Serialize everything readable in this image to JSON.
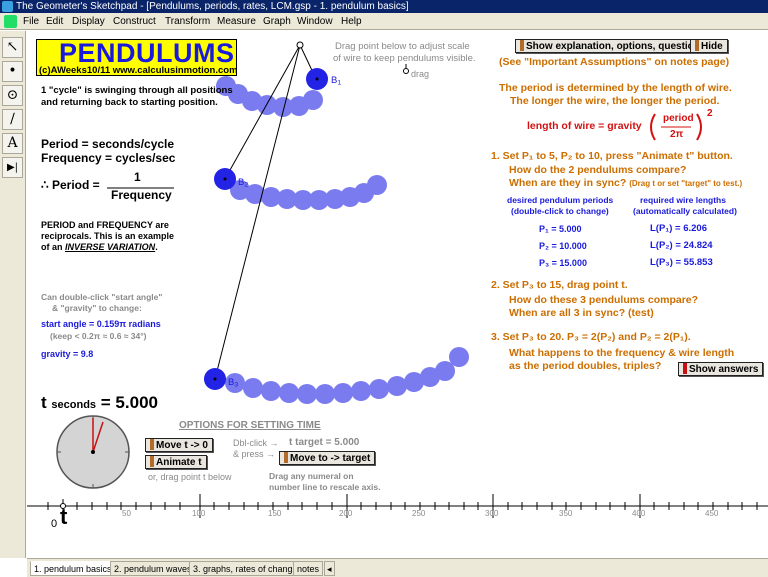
{
  "window": {
    "title": "The Geometer's Sketchpad - [Pendulums, periods, rates, LCM.gsp - 1. pendulum basics]"
  },
  "menu": [
    "File",
    "Edit",
    "Display",
    "Construct",
    "Transform",
    "Measure",
    "Graph",
    "Window",
    "Help"
  ],
  "tools": [
    {
      "name": "arrow-tool-icon",
      "glyph": "↖"
    },
    {
      "name": "point-tool-icon",
      "glyph": "•"
    },
    {
      "name": "compass-tool-icon",
      "glyph": "⊙"
    },
    {
      "name": "straightedge-tool-icon",
      "glyph": "∕"
    },
    {
      "name": "text-tool-icon",
      "glyph": "A"
    },
    {
      "name": "custom-tool-icon",
      "glyph": "▶|"
    }
  ],
  "header": {
    "title": "PENDULUMS",
    "credit": "(c)AWeeks10/11 www.calculusinmotion.com"
  },
  "cycle": {
    "line1": "1 \"cycle\" is swinging through all positions",
    "line2": "and returning back to starting position."
  },
  "defs": {
    "period": "Period = seconds/cycle",
    "frequency": "Frequency = cycles/sec",
    "therefore": "∴ Period =",
    "numerator": "1",
    "denominator": "Frequency"
  },
  "reciprocal": {
    "line1": "PERIOD and FREQUENCY are",
    "line2": "reciprocals.  This is an example",
    "line3_prefix": "of an ",
    "line3_em": "INVERSE VARIATION",
    "line3_suffix": "."
  },
  "params": {
    "hint1": "Can double-click \"start angle\"",
    "hint2": "& \"gravity\" to change:",
    "start_angle": "start angle = 0.159π radians",
    "keep": "(keep < 0.2π ≈ 0.6 ≈ 34°)",
    "gravity": "gravity = 9.8"
  },
  "time": {
    "label": "t",
    "sub": "seconds",
    "value": "= 5.000"
  },
  "drag_hint": {
    "line1": "Drag point below to adjust scale",
    "line2": "of wire to keep pendulums visible.",
    "drag": "drag"
  },
  "pendulum_labels": {
    "b1": "B",
    "b1_sub": "1",
    "b2": "B",
    "b2_sub": "2",
    "b3": "B",
    "b3_sub": "3"
  },
  "options": {
    "heading": "OPTIONS FOR SETTING TIME",
    "move_t0": "Move t -> 0",
    "animate": "Animate t",
    "or_drag": "or, drag point t below",
    "dblclick": "Dbl-click →",
    "press": "& press →",
    "t_target": "t target = 5.000",
    "move_target": "Move to -> target",
    "numeral_hint1": "Drag any numeral on",
    "numeral_hint2": "number line to rescale axis."
  },
  "numberline": {
    "zero": "0",
    "t_label": "t",
    "ticks": [
      "50",
      "100",
      "150",
      "200",
      "250",
      "300",
      "350",
      "400",
      "450"
    ]
  },
  "right": {
    "show_btn": "Show explanation, options, questions",
    "hide_btn": "Hide",
    "see": "(See \"Important Assumptions\" on notes page)",
    "period_line1": "The period is determined by the length of wire.",
    "period_line2": "The longer the wire, the longer the period.",
    "formula_lhs": "length of wire = gravity",
    "formula_num": "period",
    "formula_den": "2π",
    "formula_exp": "2",
    "q1_line1": "1.  Set P₁ to 5,  P₂ to 10, press \"Animate t\" button.",
    "q1_line2": "How do the 2 pendulums compare?",
    "q1_line3": "When are they in sync?",
    "q1_line3_small": "(Drag t or set \"target\" to test.)",
    "col1_h1": "desired pendulum periods",
    "col1_h2": "(double-click to change)",
    "col2_h1": "required wire lengths",
    "col2_h2": "(automatically calculated)",
    "periods": [
      "P₁ = 5.000",
      "P₂ = 10.000",
      "P₃ = 15.000"
    ],
    "lengths": [
      "L(P₁) = 6.206",
      "L(P₂) = 24.824",
      "L(P₃) = 55.853"
    ],
    "q2_line1": "2.  Set P₃ to 15, drag point t.",
    "q2_line2": "How do these 3 pendulums compare?",
    "q2_line3": "When are all 3 in sync?  (test)",
    "q3_line1": "3.  Set P₃ to 20.  P₃ = 2(P₂)  and P₂ = 2(P₁).",
    "q3_line2": "What happens to the frequency & wire length",
    "q3_line3": "as the period doubles, triples?",
    "show_answers": "Show answers"
  },
  "tabs": [
    "1. pendulum basics",
    "2. pendulum waves",
    "3. graphs, rates of change",
    "notes"
  ],
  "colors": {
    "bob": "#2323e6",
    "trail": "#7b7bf0",
    "title_bg": "#ffff00",
    "accent_red": "#d41010",
    "orange": "#cc6e00",
    "text_blue": "#1a1adc"
  }
}
